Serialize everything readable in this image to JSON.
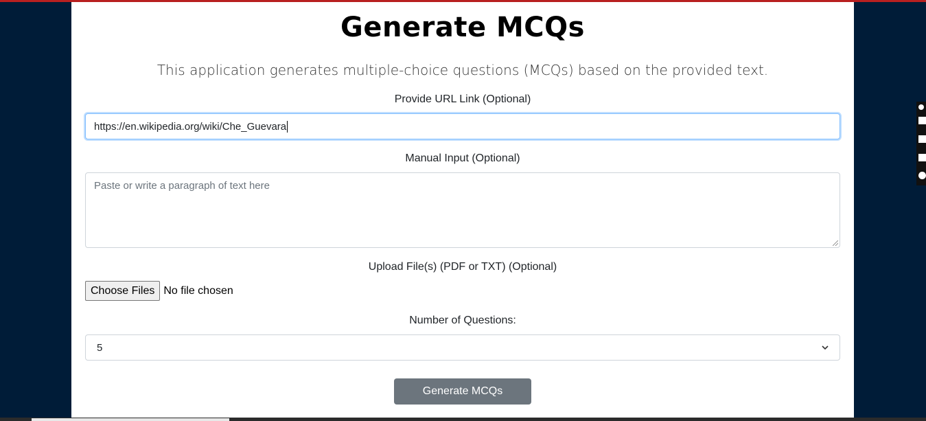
{
  "page": {
    "title": "Generate MCQs",
    "description": "This application generates multiple-choice questions (MCQs) based on the provided text."
  },
  "url_field": {
    "label": "Provide URL Link (Optional)",
    "value": "https://en.wikipedia.org/wiki/Che_Guevara"
  },
  "manual_input": {
    "label": "Manual Input (Optional)",
    "placeholder": "Paste or write a paragraph of text here"
  },
  "upload": {
    "label": "Upload File(s) (PDF or TXT) (Optional)",
    "button_label": "Choose Files",
    "status": "No file chosen"
  },
  "questions": {
    "label": "Number of Questions:",
    "selected": "5"
  },
  "submit": {
    "label": "Generate MCQs"
  },
  "colors": {
    "background": "#001c38",
    "card": "#ffffff",
    "button": "#6c757d",
    "focus_border": "#80bdff",
    "top_strip": "#b82020"
  },
  "icons": {
    "select_arrow": "chevron-down-icon",
    "textarea_resize": "resize-grip-icon"
  }
}
